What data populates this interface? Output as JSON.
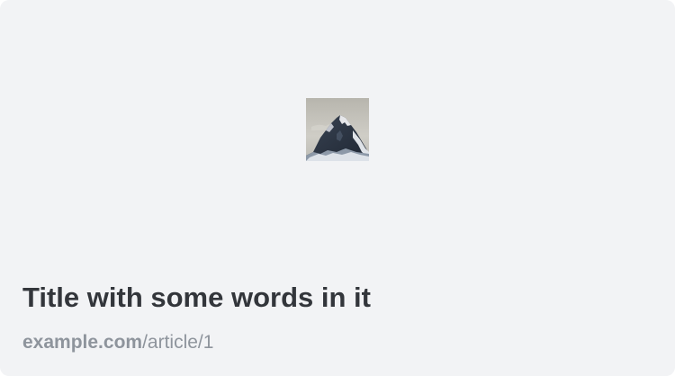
{
  "card": {
    "image_icon": "mountain-thumbnail-icon",
    "title": "Title with some words in it",
    "link": {
      "domain": "example.com",
      "path": "/article/1"
    }
  },
  "colors": {
    "card_background": "#f2f3f5",
    "title_text": "#33363b",
    "link_text": "#8e949c"
  }
}
